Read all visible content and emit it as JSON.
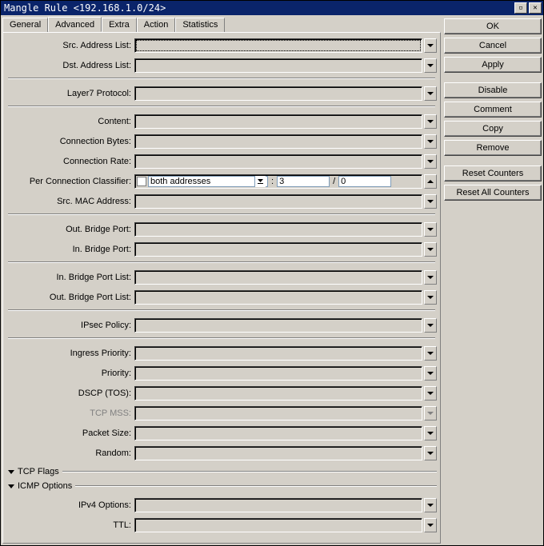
{
  "window": {
    "title": "Mangle Rule <192.168.1.0/24>"
  },
  "tabs": [
    "General",
    "Advanced",
    "Extra",
    "Action",
    "Statistics"
  ],
  "active_tab": "Advanced",
  "sections": {
    "s1": [
      {
        "key": "src_addr_list",
        "label": "Src. Address List:"
      },
      {
        "key": "dst_addr_list",
        "label": "Dst. Address List:"
      }
    ],
    "s2": [
      {
        "key": "layer7",
        "label": "Layer7 Protocol:"
      }
    ],
    "s3": [
      {
        "key": "content",
        "label": "Content:"
      },
      {
        "key": "conn_bytes",
        "label": "Connection Bytes:"
      },
      {
        "key": "conn_rate",
        "label": "Connection Rate:"
      }
    ],
    "pcc": {
      "label": "Per Connection Classifier:",
      "mode": "both addresses",
      "divisor": "3",
      "remainder": "0"
    },
    "s3b": [
      {
        "key": "src_mac",
        "label": "Src. MAC Address:"
      }
    ],
    "s4": [
      {
        "key": "out_bridge",
        "label": "Out. Bridge Port:"
      },
      {
        "key": "in_bridge",
        "label": "In. Bridge Port:"
      }
    ],
    "s5": [
      {
        "key": "in_bridge_list",
        "label": "In. Bridge Port List:"
      },
      {
        "key": "out_bridge_list",
        "label": "Out. Bridge Port List:"
      }
    ],
    "s6": [
      {
        "key": "ipsec",
        "label": "IPsec Policy:"
      }
    ],
    "s7": [
      {
        "key": "ingress_prio",
        "label": "Ingress Priority:"
      },
      {
        "key": "priority",
        "label": "Priority:"
      },
      {
        "key": "dscp",
        "label": "DSCP (TOS):"
      },
      {
        "key": "tcp_mss",
        "label": "TCP MSS:",
        "disabled": true
      },
      {
        "key": "packet_size",
        "label": "Packet Size:"
      },
      {
        "key": "random",
        "label": "Random:"
      }
    ],
    "tcp_flags": "TCP Flags",
    "icmp_options": "ICMP Options",
    "s8": [
      {
        "key": "ipv4_opts",
        "label": "IPv4 Options:"
      },
      {
        "key": "ttl",
        "label": "TTL:"
      }
    ]
  },
  "buttons": {
    "ok": "OK",
    "cancel": "Cancel",
    "apply": "Apply",
    "disable": "Disable",
    "comment": "Comment",
    "copy": "Copy",
    "remove": "Remove",
    "reset_counters": "Reset Counters",
    "reset_all_counters": "Reset All Counters"
  }
}
